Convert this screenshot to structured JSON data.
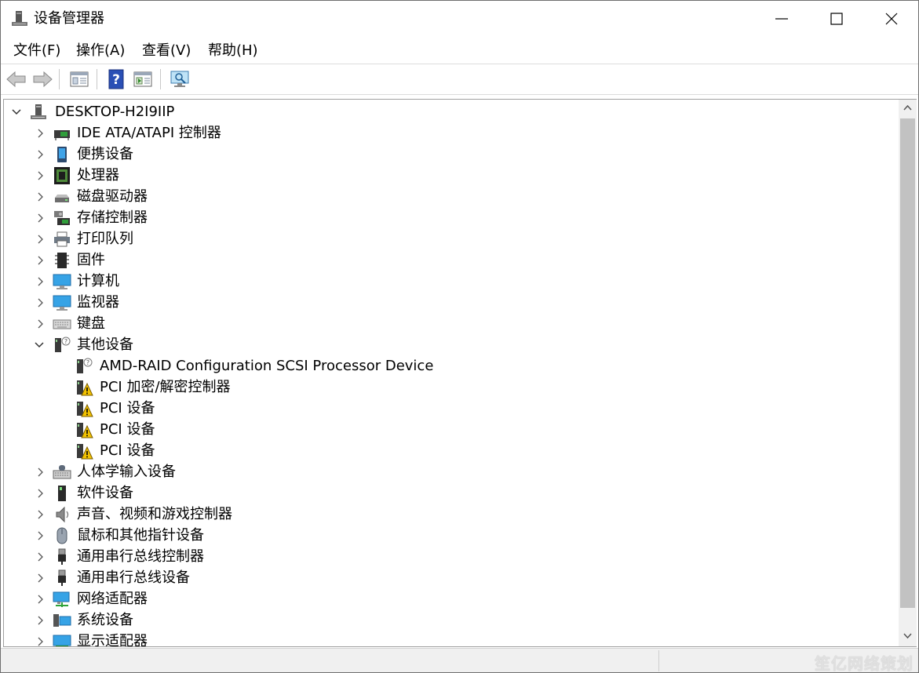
{
  "window": {
    "title": "设备管理器"
  },
  "menu": [
    {
      "label": "文件(F)"
    },
    {
      "label": "操作(A)"
    },
    {
      "label": "查看(V)"
    },
    {
      "label": "帮助(H)"
    }
  ],
  "toolbar": {
    "buttons": [
      "back-arrow-icon",
      "forward-arrow-icon",
      "properties-icon",
      "help-icon",
      "update-driver-icon",
      "scan-hardware-icon"
    ]
  },
  "tree": {
    "root": {
      "label": "DESKTOP-H2I9IIP",
      "icon": "computer-tower-icon",
      "expanded": true
    },
    "categories": [
      {
        "label": "IDE ATA/ATAPI 控制器",
        "icon": "ide-controller-icon"
      },
      {
        "label": "便携设备",
        "icon": "portable-device-icon"
      },
      {
        "label": "处理器",
        "icon": "processor-icon"
      },
      {
        "label": "磁盘驱动器",
        "icon": "disk-drive-icon"
      },
      {
        "label": "存储控制器",
        "icon": "storage-controller-icon"
      },
      {
        "label": "打印队列",
        "icon": "printer-icon"
      },
      {
        "label": "固件",
        "icon": "firmware-icon"
      },
      {
        "label": "计算机",
        "icon": "computer-icon"
      },
      {
        "label": "监视器",
        "icon": "monitor-icon"
      },
      {
        "label": "键盘",
        "icon": "keyboard-icon"
      },
      {
        "label": "其他设备",
        "icon": "unknown-device-icon",
        "expanded": true,
        "children": [
          {
            "label": "AMD-RAID Configuration SCSI Processor Device",
            "icon": "unknown-device-icon"
          },
          {
            "label": "PCI 加密/解密控制器",
            "icon": "warning-device-icon"
          },
          {
            "label": "PCI 设备",
            "icon": "warning-device-icon"
          },
          {
            "label": "PCI 设备",
            "icon": "warning-device-icon"
          },
          {
            "label": "PCI 设备",
            "icon": "warning-device-icon"
          }
        ]
      },
      {
        "label": "人体学输入设备",
        "icon": "hid-icon"
      },
      {
        "label": "软件设备",
        "icon": "software-device-icon"
      },
      {
        "label": "声音、视频和游戏控制器",
        "icon": "speaker-icon"
      },
      {
        "label": "鼠标和其他指针设备",
        "icon": "mouse-icon"
      },
      {
        "label": "通用串行总线控制器",
        "icon": "usb-icon"
      },
      {
        "label": "通用串行总线设备",
        "icon": "usb-icon"
      },
      {
        "label": "网络适配器",
        "icon": "network-adapter-icon"
      },
      {
        "label": "系统设备",
        "icon": "system-device-icon"
      },
      {
        "label": "显示适配器",
        "icon": "display-adapter-icon"
      }
    ]
  },
  "statusbar": {
    "watermark": "笙亿网络策划"
  },
  "colors": {
    "accent": "#1e88d8",
    "warning": "#f2c200",
    "scrollbar": "#c2c2c2"
  }
}
